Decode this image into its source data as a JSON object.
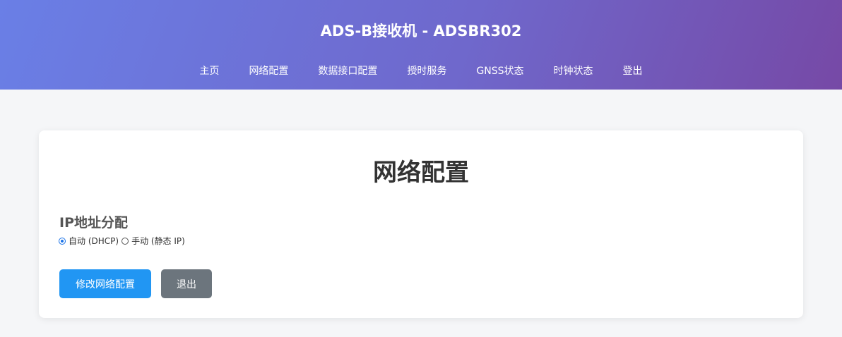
{
  "header": {
    "title": "ADS-B接收机 - ADSBR302",
    "nav": [
      {
        "label": "主页"
      },
      {
        "label": "网络配置"
      },
      {
        "label": "数据接口配置"
      },
      {
        "label": "授时服务"
      },
      {
        "label": "GNSS状态"
      },
      {
        "label": "时钟状态"
      },
      {
        "label": "登出"
      }
    ]
  },
  "main": {
    "title": "网络配置",
    "section_label": "IP地址分配",
    "options": [
      {
        "label": "自动 (DHCP)",
        "checked": true
      },
      {
        "label": "手动 (静态 IP)",
        "checked": false
      }
    ],
    "buttons": {
      "modify_label": "修改网络配置",
      "exit_label": "退出"
    }
  },
  "colors": {
    "primary": "#2196f3",
    "secondary": "#6c757d",
    "radio_accent": "#1a73e8"
  }
}
